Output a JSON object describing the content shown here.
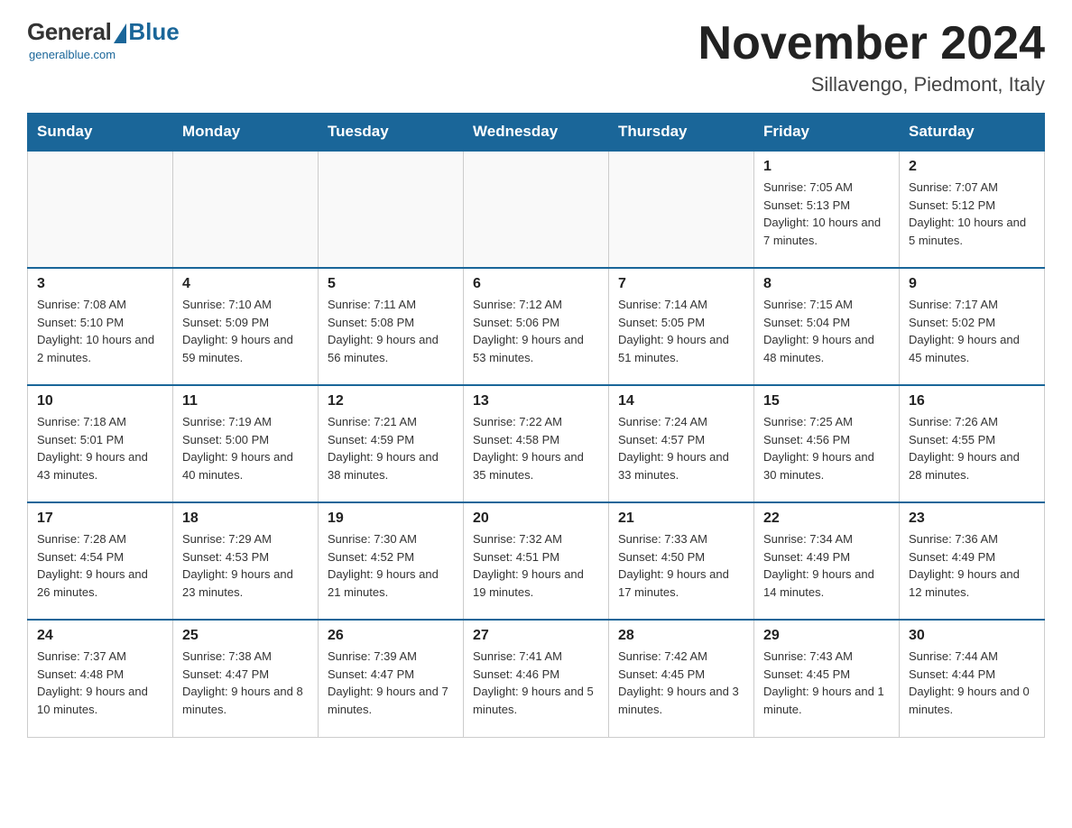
{
  "header": {
    "logo_general": "General",
    "logo_blue": "Blue",
    "logo_subtitle": "generalblue.com",
    "title": "November 2024",
    "subtitle": "Sillavengo, Piedmont, Italy"
  },
  "weekdays": [
    "Sunday",
    "Monday",
    "Tuesday",
    "Wednesday",
    "Thursday",
    "Friday",
    "Saturday"
  ],
  "weeks": [
    {
      "days": [
        {
          "number": "",
          "info": "",
          "empty": true
        },
        {
          "number": "",
          "info": "",
          "empty": true
        },
        {
          "number": "",
          "info": "",
          "empty": true
        },
        {
          "number": "",
          "info": "",
          "empty": true
        },
        {
          "number": "",
          "info": "",
          "empty": true
        },
        {
          "number": "1",
          "info": "Sunrise: 7:05 AM\nSunset: 5:13 PM\nDaylight: 10 hours and 7 minutes."
        },
        {
          "number": "2",
          "info": "Sunrise: 7:07 AM\nSunset: 5:12 PM\nDaylight: 10 hours and 5 minutes."
        }
      ]
    },
    {
      "days": [
        {
          "number": "3",
          "info": "Sunrise: 7:08 AM\nSunset: 5:10 PM\nDaylight: 10 hours and 2 minutes."
        },
        {
          "number": "4",
          "info": "Sunrise: 7:10 AM\nSunset: 5:09 PM\nDaylight: 9 hours and 59 minutes."
        },
        {
          "number": "5",
          "info": "Sunrise: 7:11 AM\nSunset: 5:08 PM\nDaylight: 9 hours and 56 minutes."
        },
        {
          "number": "6",
          "info": "Sunrise: 7:12 AM\nSunset: 5:06 PM\nDaylight: 9 hours and 53 minutes."
        },
        {
          "number": "7",
          "info": "Sunrise: 7:14 AM\nSunset: 5:05 PM\nDaylight: 9 hours and 51 minutes."
        },
        {
          "number": "8",
          "info": "Sunrise: 7:15 AM\nSunset: 5:04 PM\nDaylight: 9 hours and 48 minutes."
        },
        {
          "number": "9",
          "info": "Sunrise: 7:17 AM\nSunset: 5:02 PM\nDaylight: 9 hours and 45 minutes."
        }
      ]
    },
    {
      "days": [
        {
          "number": "10",
          "info": "Sunrise: 7:18 AM\nSunset: 5:01 PM\nDaylight: 9 hours and 43 minutes."
        },
        {
          "number": "11",
          "info": "Sunrise: 7:19 AM\nSunset: 5:00 PM\nDaylight: 9 hours and 40 minutes."
        },
        {
          "number": "12",
          "info": "Sunrise: 7:21 AM\nSunset: 4:59 PM\nDaylight: 9 hours and 38 minutes."
        },
        {
          "number": "13",
          "info": "Sunrise: 7:22 AM\nSunset: 4:58 PM\nDaylight: 9 hours and 35 minutes."
        },
        {
          "number": "14",
          "info": "Sunrise: 7:24 AM\nSunset: 4:57 PM\nDaylight: 9 hours and 33 minutes."
        },
        {
          "number": "15",
          "info": "Sunrise: 7:25 AM\nSunset: 4:56 PM\nDaylight: 9 hours and 30 minutes."
        },
        {
          "number": "16",
          "info": "Sunrise: 7:26 AM\nSunset: 4:55 PM\nDaylight: 9 hours and 28 minutes."
        }
      ]
    },
    {
      "days": [
        {
          "number": "17",
          "info": "Sunrise: 7:28 AM\nSunset: 4:54 PM\nDaylight: 9 hours and 26 minutes."
        },
        {
          "number": "18",
          "info": "Sunrise: 7:29 AM\nSunset: 4:53 PM\nDaylight: 9 hours and 23 minutes."
        },
        {
          "number": "19",
          "info": "Sunrise: 7:30 AM\nSunset: 4:52 PM\nDaylight: 9 hours and 21 minutes."
        },
        {
          "number": "20",
          "info": "Sunrise: 7:32 AM\nSunset: 4:51 PM\nDaylight: 9 hours and 19 minutes."
        },
        {
          "number": "21",
          "info": "Sunrise: 7:33 AM\nSunset: 4:50 PM\nDaylight: 9 hours and 17 minutes."
        },
        {
          "number": "22",
          "info": "Sunrise: 7:34 AM\nSunset: 4:49 PM\nDaylight: 9 hours and 14 minutes."
        },
        {
          "number": "23",
          "info": "Sunrise: 7:36 AM\nSunset: 4:49 PM\nDaylight: 9 hours and 12 minutes."
        }
      ]
    },
    {
      "days": [
        {
          "number": "24",
          "info": "Sunrise: 7:37 AM\nSunset: 4:48 PM\nDaylight: 9 hours and 10 minutes."
        },
        {
          "number": "25",
          "info": "Sunrise: 7:38 AM\nSunset: 4:47 PM\nDaylight: 9 hours and 8 minutes."
        },
        {
          "number": "26",
          "info": "Sunrise: 7:39 AM\nSunset: 4:47 PM\nDaylight: 9 hours and 7 minutes."
        },
        {
          "number": "27",
          "info": "Sunrise: 7:41 AM\nSunset: 4:46 PM\nDaylight: 9 hours and 5 minutes."
        },
        {
          "number": "28",
          "info": "Sunrise: 7:42 AM\nSunset: 4:45 PM\nDaylight: 9 hours and 3 minutes."
        },
        {
          "number": "29",
          "info": "Sunrise: 7:43 AM\nSunset: 4:45 PM\nDaylight: 9 hours and 1 minute."
        },
        {
          "number": "30",
          "info": "Sunrise: 7:44 AM\nSunset: 4:44 PM\nDaylight: 9 hours and 0 minutes."
        }
      ]
    }
  ]
}
